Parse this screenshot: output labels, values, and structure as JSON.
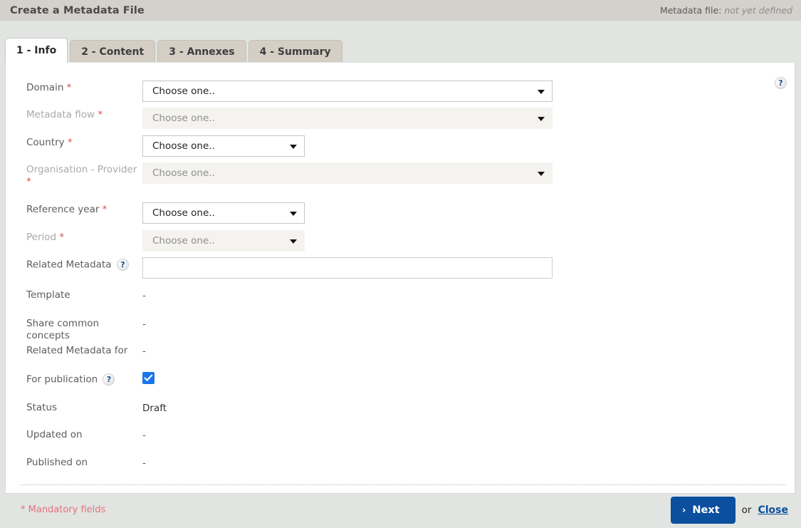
{
  "titlebar": {
    "title": "Create a Metadata File",
    "metadata_file_label": "Metadata file:",
    "metadata_file_value": "not yet defined"
  },
  "tabs": [
    {
      "label": "1 - Info",
      "active": true
    },
    {
      "label": "2 - Content",
      "active": false
    },
    {
      "label": "3 - Annexes",
      "active": false
    },
    {
      "label": "4 - Summary",
      "active": false
    }
  ],
  "panel": {
    "help_icon_glyph": "?"
  },
  "form": {
    "rows": [
      {
        "key": "domain",
        "label": "Domain",
        "required": true,
        "disabled": false,
        "control": "select",
        "value": "Choose one..",
        "width": "wide"
      },
      {
        "key": "metadata_flow",
        "label": "Metadata flow",
        "required": true,
        "disabled": true,
        "control": "select",
        "value": "Choose one..",
        "width": "wide"
      },
      {
        "key": "country",
        "label": "Country",
        "required": true,
        "disabled": false,
        "control": "select",
        "value": "Choose one..",
        "width": "narrow"
      },
      {
        "key": "organisation_provider",
        "label": "Organisation - Provider",
        "required": true,
        "disabled": true,
        "control": "select",
        "value": "Choose one..",
        "width": "wide"
      },
      {
        "key": "reference_year",
        "label": "Reference year",
        "required": true,
        "disabled": false,
        "control": "select",
        "value": "Choose one..",
        "width": "narrow"
      },
      {
        "key": "period",
        "label": "Period",
        "required": true,
        "disabled": true,
        "control": "select",
        "value": "Choose one..",
        "width": "narrow"
      },
      {
        "key": "related_metadata",
        "label": "Related Metadata",
        "required": false,
        "help": true,
        "disabled": false,
        "control": "text",
        "value": "",
        "placeholder": ""
      },
      {
        "key": "template",
        "label": "Template",
        "required": false,
        "disabled": false,
        "control": "static",
        "value": "-"
      },
      {
        "key": "share_common_concepts",
        "label": "Share common concepts",
        "required": false,
        "disabled": false,
        "control": "static",
        "value": "-"
      },
      {
        "key": "related_metadata_for",
        "label": "Related Metadata for",
        "required": false,
        "disabled": false,
        "control": "static",
        "value": "-"
      },
      {
        "key": "for_publication",
        "label": "For publication",
        "required": false,
        "help": true,
        "disabled": false,
        "control": "checkbox",
        "checked": true
      },
      {
        "key": "status",
        "label": "Status",
        "required": false,
        "disabled": false,
        "control": "static",
        "value": "Draft"
      },
      {
        "key": "updated_on",
        "label": "Updated on",
        "required": false,
        "disabled": false,
        "control": "static",
        "value": "-"
      },
      {
        "key": "published_on",
        "label": "Published on",
        "required": false,
        "disabled": false,
        "control": "static",
        "value": "-"
      }
    ]
  },
  "footer": {
    "mandatory_note": "* Mandatory fields",
    "next_label": "Next",
    "next_chevron": "›",
    "or_label": "or",
    "close_label": "Close"
  },
  "colors": {
    "titlebar_bg": "#d4d0cb",
    "page_bg": "#e1e4e1",
    "tab_inactive_bg": "#d4cec5",
    "tab_active_bg": "#ffffff",
    "accent_blue": "#0b4f9e",
    "checkbox_blue": "#1877e8",
    "required_red": "#d9534f",
    "mandatory_red": "#e4737a",
    "disabled_field_bg": "#f4f3f0"
  }
}
